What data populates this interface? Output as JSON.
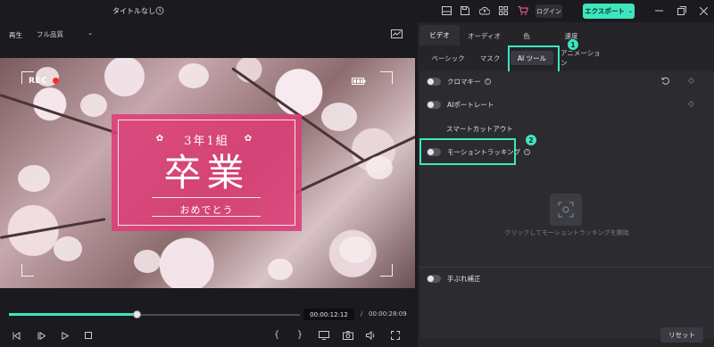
{
  "app": {
    "title": "タイトルなし",
    "login_label": "ログイン",
    "export_label": "エクスポート",
    "accent_color": "#3ee6bf"
  },
  "preview": {
    "playback_label": "再生",
    "quality": "フル品質",
    "overlay": {
      "rec_label": "REC",
      "title_top": "3年1組",
      "title_main": "卒業",
      "title_bottom": "おめでとう"
    },
    "time_current": "00:00:12:12",
    "time_separator": "/",
    "time_total": "00:00:28:09",
    "progress_fraction": 0.44
  },
  "panel": {
    "tabs": [
      {
        "label": "ビデオ",
        "active": true
      },
      {
        "label": "オーディオ",
        "active": false
      },
      {
        "label": "色",
        "active": false
      },
      {
        "label": "速度",
        "active": false
      }
    ],
    "subtabs": [
      {
        "label": "ベーシック",
        "active": false
      },
      {
        "label": "マスク",
        "active": false
      },
      {
        "label": "AI ツール",
        "active": true
      },
      {
        "label": "アニメーション",
        "active": false
      }
    ],
    "features": [
      {
        "label": "クロマキー",
        "has_help": true,
        "enabled": false
      },
      {
        "label": "AIポートレート",
        "has_help": false,
        "enabled": false
      },
      {
        "label": "スマートカットアウト",
        "has_help": false,
        "enabled": false
      },
      {
        "label": "モーショントラッキング",
        "has_help": true,
        "enabled": false
      },
      {
        "label": "手ぶれ補正",
        "has_help": false,
        "enabled": false
      }
    ],
    "motion_hint": "クリックしてモーショントラッキングを開始",
    "reset_label": "リセット",
    "badges": [
      "1",
      "2"
    ]
  }
}
